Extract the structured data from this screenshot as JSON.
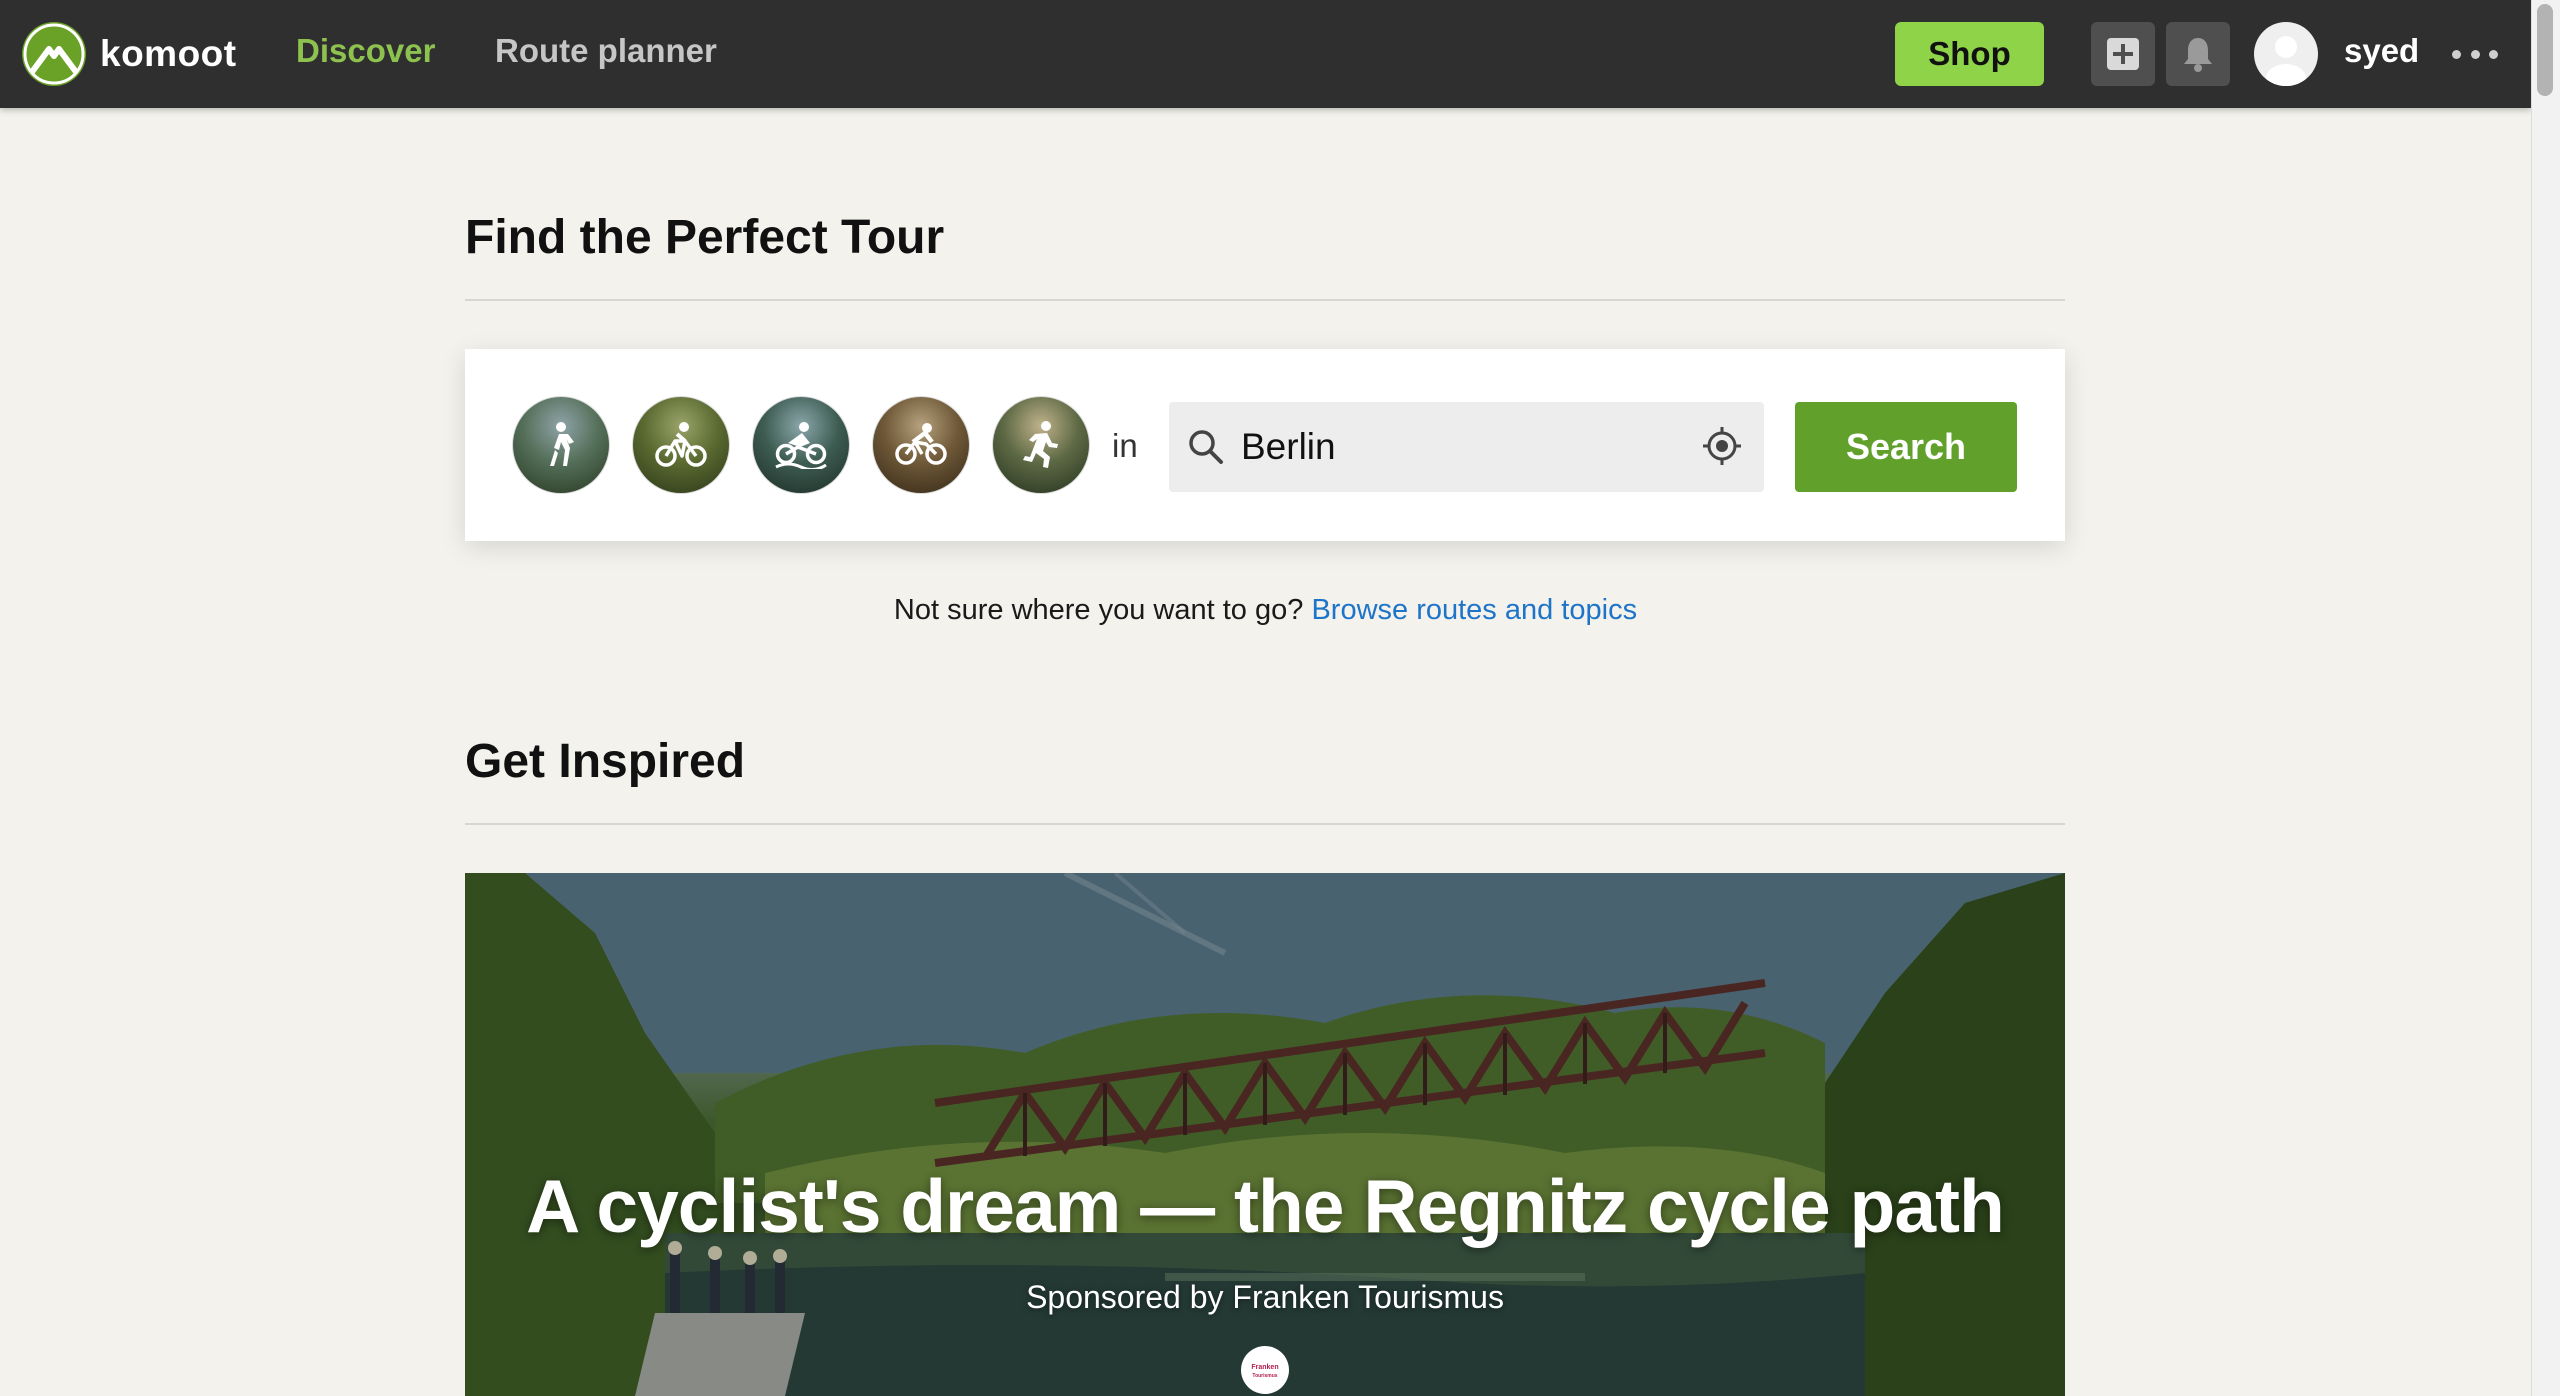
{
  "header": {
    "logo_text": "komoot",
    "nav": {
      "discover": "Discover",
      "route_planner": "Route planner"
    },
    "shop_label": "Shop",
    "username": "syed"
  },
  "find_section": {
    "title": "Find the Perfect Tour",
    "sports": [
      {
        "name": "hiking"
      },
      {
        "name": "bike-touring"
      },
      {
        "name": "road-cycling"
      },
      {
        "name": "mountain-biking"
      },
      {
        "name": "running"
      }
    ],
    "in_label": "in",
    "location_value": "Berlin",
    "search_label": "Search",
    "browse_prefix": "Not sure where you want to go?",
    "browse_link": "Browse routes and topics"
  },
  "inspired_section": {
    "title": "Get Inspired",
    "hero_title": "A cyclist's dream — the Regnitz cycle path",
    "hero_sponsor": "Sponsored by Franken Tourismus",
    "sponsor_logo_text": "Franken Tourismus"
  },
  "colors": {
    "topbar": "#2f2f2f",
    "accent_green": "#61a12b",
    "discover_green": "#8ec24f",
    "shop_green": "#8fd349",
    "link_blue": "#1e74c9",
    "page_bg": "#f3f2ec"
  },
  "icons": {
    "logo": "mountain-logo-icon",
    "create": "plus-square-icon",
    "notifications": "bell-icon",
    "more": "ellipsis-icon",
    "search": "magnifier-icon",
    "locate": "crosshair-icon"
  }
}
